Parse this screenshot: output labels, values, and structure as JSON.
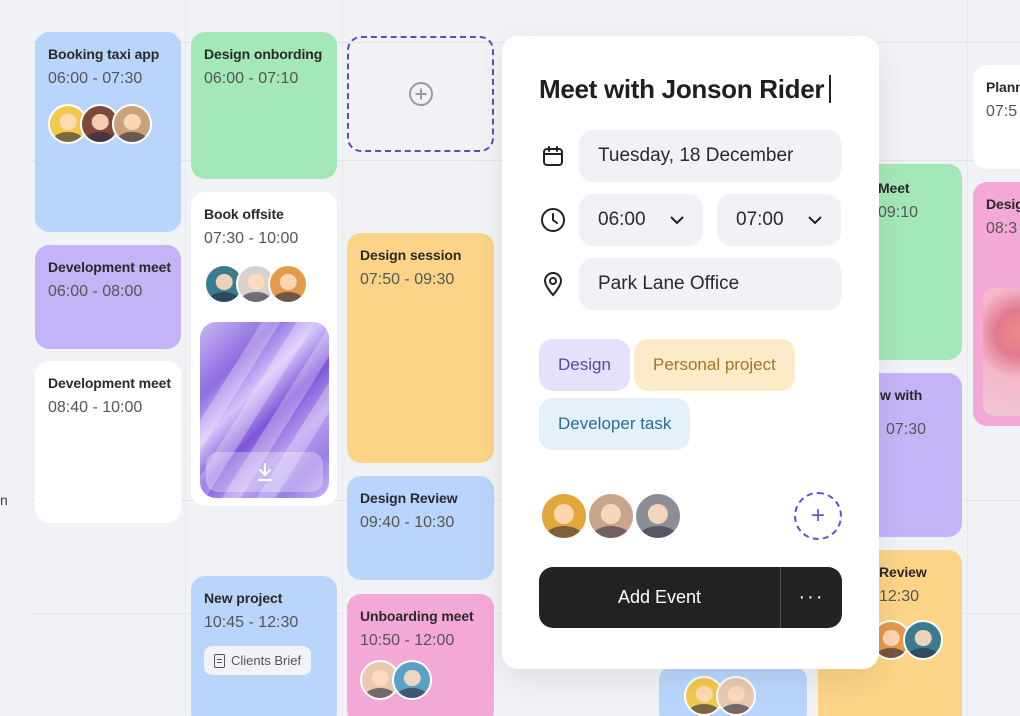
{
  "events": {
    "booking_taxi": {
      "title": "Booking taxi app",
      "time": "06:00 - 07:30"
    },
    "design_onbording": {
      "title": "Design onbording",
      "time": "06:00 - 07:10"
    },
    "book_offsite": {
      "title": "Book offsite",
      "time": "07:30 - 10:00"
    },
    "dev_meet_1": {
      "title": "Development meet",
      "time": "06:00 - 08:00"
    },
    "dev_meet_2": {
      "title": "Development meet",
      "time": "08:40 - 10:00"
    },
    "design_session": {
      "title": "Design session",
      "time": "07:50 - 09:30"
    },
    "design_review": {
      "title": "Design Review",
      "time": "09:40 - 10:30"
    },
    "new_project": {
      "title": "New project",
      "time": "10:45 - 12:30",
      "attachment": "Clients Brief"
    },
    "unboarding_meet": {
      "title": "Unboarding meet",
      "time": "10:50 - 12:00"
    },
    "right_meet": {
      "title": "Meet",
      "time": "09:10"
    },
    "right_interview": {
      "title": "w with",
      "time": "07:30"
    },
    "right_review": {
      "title": "Review",
      "time": "12:30"
    },
    "far_plan": {
      "title": "Plann",
      "time": "07:5"
    },
    "far_design": {
      "title": "Desig",
      "time": "08:3"
    }
  },
  "modal": {
    "title": "Meet with Jonson Rider",
    "date": "Tuesday, 18 December",
    "start_time": "06:00",
    "end_time": "07:00",
    "location": "Park Lane Office",
    "tags": [
      "Design",
      "Personal project",
      "Developer task"
    ],
    "add_button": "Add Event",
    "more_button": "···"
  },
  "side_label": "n"
}
